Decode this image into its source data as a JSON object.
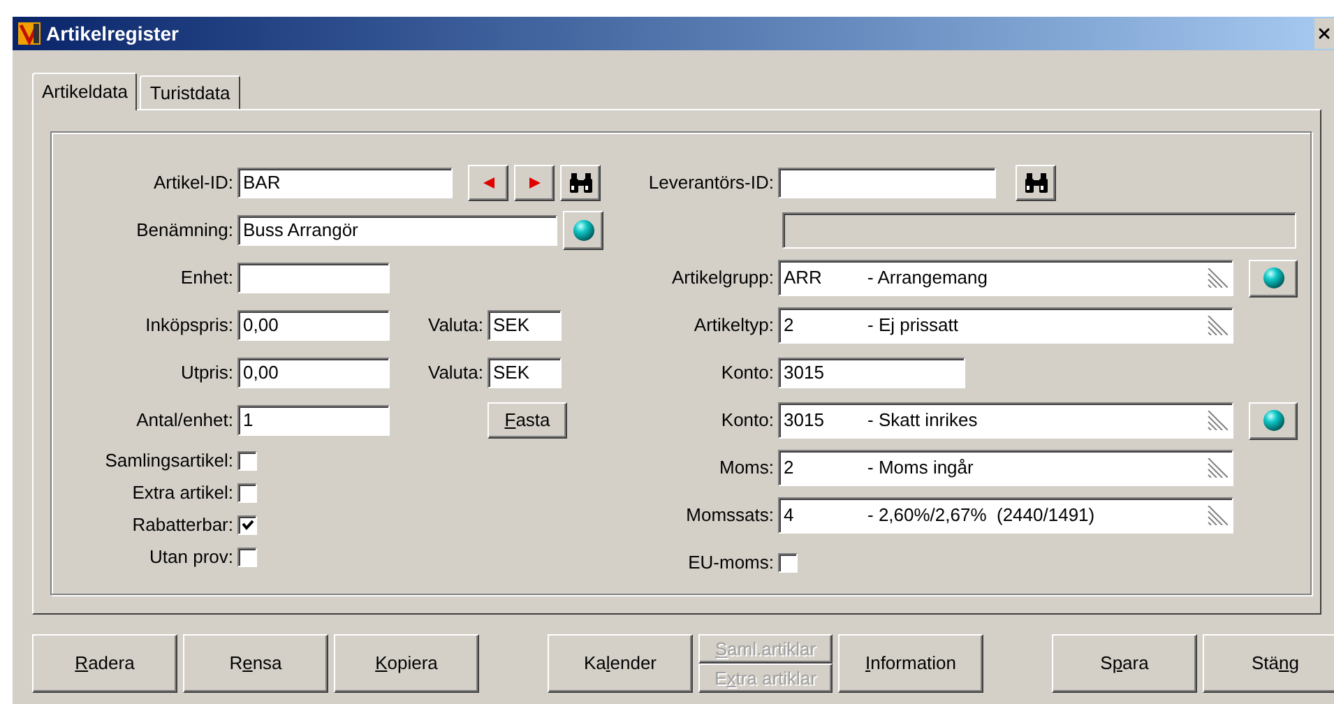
{
  "window": {
    "title": "Artikelregister"
  },
  "tabs": [
    {
      "label": "Artikeldata",
      "selected": true
    },
    {
      "label": "Turistdata",
      "selected": false
    }
  ],
  "left_rows": [
    {
      "kind": "id",
      "label": "Artikel-ID:",
      "value": "BAR"
    },
    {
      "kind": "lookup",
      "label": "Benämning:",
      "value": "Buss Arrangör"
    },
    {
      "kind": "text",
      "label": "Enhet:"
    },
    {
      "kind": "currency",
      "label": "Inköpspris:",
      "value": "0,00",
      "currency_label": "Valuta:",
      "currency": "SEK"
    },
    {
      "kind": "currency",
      "label": "Utpris:",
      "value": "0,00",
      "currency_label": "Valuta:",
      "currency": "SEK"
    },
    {
      "kind": "button",
      "label": "Antal/enhet:",
      "value": "1",
      "button": {
        "key": "F",
        "after": "asta"
      }
    },
    {
      "kind": "checkbox",
      "label": "Samlingsartikel:",
      "checked": false
    },
    {
      "kind": "checkbox",
      "label": "Extra artikel:",
      "checked": false
    },
    {
      "kind": "checkbox",
      "label": "Rabatterbar:",
      "checked": true
    },
    {
      "kind": "checkbox",
      "label": "Utan prov:",
      "checked": false
    }
  ],
  "right_rows": [
    {
      "kind": "search",
      "label": "Leverantörs-ID:"
    },
    {
      "kind": "readonly"
    },
    {
      "kind": "combo",
      "label": "Artikelgrupp:",
      "code": "ARR",
      "text": "- Arrangemang",
      "lookup": true
    },
    {
      "kind": "combo",
      "label": "Artikeltyp:",
      "code": "2",
      "text": "- Ej prissatt",
      "lookup": false
    },
    {
      "kind": "text",
      "label": "Konto:",
      "value": "3015"
    },
    {
      "kind": "combo",
      "label": "Konto:",
      "code": "3015",
      "text": "- Skatt inrikes",
      "lookup": true
    },
    {
      "kind": "combo",
      "label": "Moms:",
      "code": "2",
      "text": "- Moms ingår",
      "lookup": false
    },
    {
      "kind": "combo",
      "label": "Momssats:",
      "code": "4",
      "text": "- 2,60%/2,67%  (2440/1491)",
      "lookup": false
    },
    {
      "kind": "checkbox",
      "label": "EU-moms:",
      "checked": false
    }
  ],
  "button_groups": [
    [
      {
        "kind": "button",
        "key": "R",
        "after": "adera"
      },
      {
        "kind": "button",
        "before": "R",
        "key": "e",
        "after": "nsa"
      },
      {
        "kind": "button",
        "key": "K",
        "after": "opiera"
      }
    ],
    [
      {
        "kind": "button",
        "before": "Ka",
        "key": "l",
        "after": "ender"
      },
      {
        "kind": "stack",
        "items": [
          {
            "key": "S",
            "after": "aml.artiklar",
            "disabled": true
          },
          {
            "before": "E",
            "key": "x",
            "after": "tra artiklar",
            "disabled": true
          }
        ]
      },
      {
        "kind": "button",
        "key": "I",
        "after": "nformation"
      }
    ],
    [
      {
        "kind": "button",
        "before": "S",
        "key": "p",
        "after": "ara"
      },
      {
        "kind": "button",
        "before": "Stä",
        "key": "n",
        "after": "g"
      }
    ]
  ]
}
